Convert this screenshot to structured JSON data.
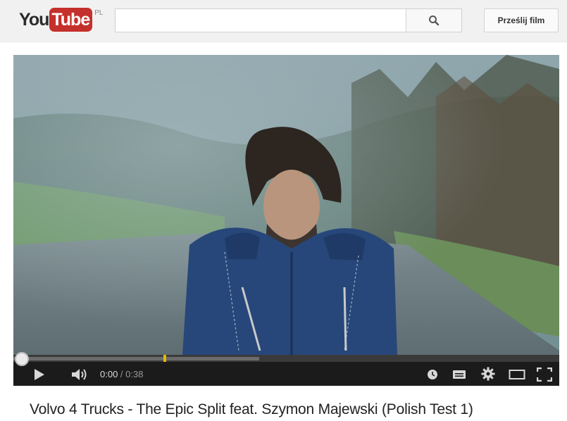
{
  "header": {
    "logo_you": "You",
    "logo_tube": "Tube",
    "logo_region": "PL",
    "search": {
      "value": "",
      "placeholder": ""
    },
    "upload_label": "Prześlij film"
  },
  "player": {
    "progress": {
      "played_fraction": 0.0,
      "buffered_fraction": 0.45,
      "marker_fraction": 0.275
    },
    "time_current": "0:00",
    "time_separator": " / ",
    "time_total": "0:38"
  },
  "video": {
    "title": "Volvo 4 Trucks - The Epic Split feat. Szymon Majewski (Polish Test 1)"
  },
  "icons": [
    "search-icon",
    "play-icon",
    "volume-icon",
    "watch-later-icon",
    "captions-icon",
    "settings-icon",
    "theater-mode-icon",
    "fullscreen-icon"
  ]
}
